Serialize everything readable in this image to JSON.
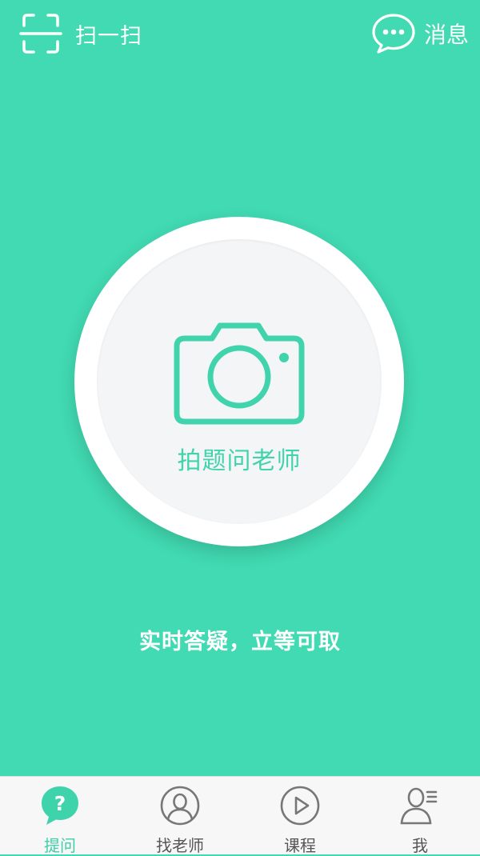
{
  "header": {
    "scan": {
      "label": "扫一扫",
      "icon": "scan-icon"
    },
    "messages": {
      "label": "消息",
      "icon": "chat-bubble-icon"
    }
  },
  "main": {
    "camera_button": {
      "label": "拍题问老师",
      "icon": "camera-icon"
    },
    "tagline": "实时答疑，立等可取"
  },
  "tabs": [
    {
      "label": "提问",
      "icon": "question-bubble-icon",
      "active": true
    },
    {
      "label": "找老师",
      "icon": "user-circle-icon",
      "active": false
    },
    {
      "label": "课程",
      "icon": "play-circle-icon",
      "active": false
    },
    {
      "label": "我",
      "icon": "profile-icon",
      "active": false
    }
  ],
  "colors": {
    "primary": "#41DAB2",
    "accent_text": "#41D3AC",
    "tab_bar_background": "#F7F7F7",
    "inactive_tab_text": "#555555",
    "inactive_tab_icon": "#777777"
  }
}
